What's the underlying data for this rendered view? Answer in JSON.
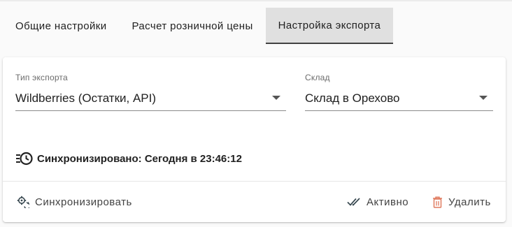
{
  "tabs": [
    {
      "label": "Общие настройки",
      "active": false
    },
    {
      "label": "Расчет розничной цены",
      "active": false
    },
    {
      "label": "Настройка экспорта",
      "active": true
    }
  ],
  "export_type": {
    "label": "Тип экспорта",
    "value": "Wildberries (Остатки, API)"
  },
  "warehouse": {
    "label": "Склад",
    "value": "Склад в Орехово"
  },
  "sync_status": {
    "text": "Синхронизировано: Сегодня в 23:46:12",
    "icon": "history-clock-icon"
  },
  "actions": {
    "sync_label": "Синхронизировать",
    "active_label": "Активно",
    "delete_label": "Удалить"
  },
  "colors": {
    "text": "#212121",
    "tab_active_bg": "#e0e0e0",
    "delete_icon": "#e07a5f",
    "action_icon": "#37474f"
  }
}
